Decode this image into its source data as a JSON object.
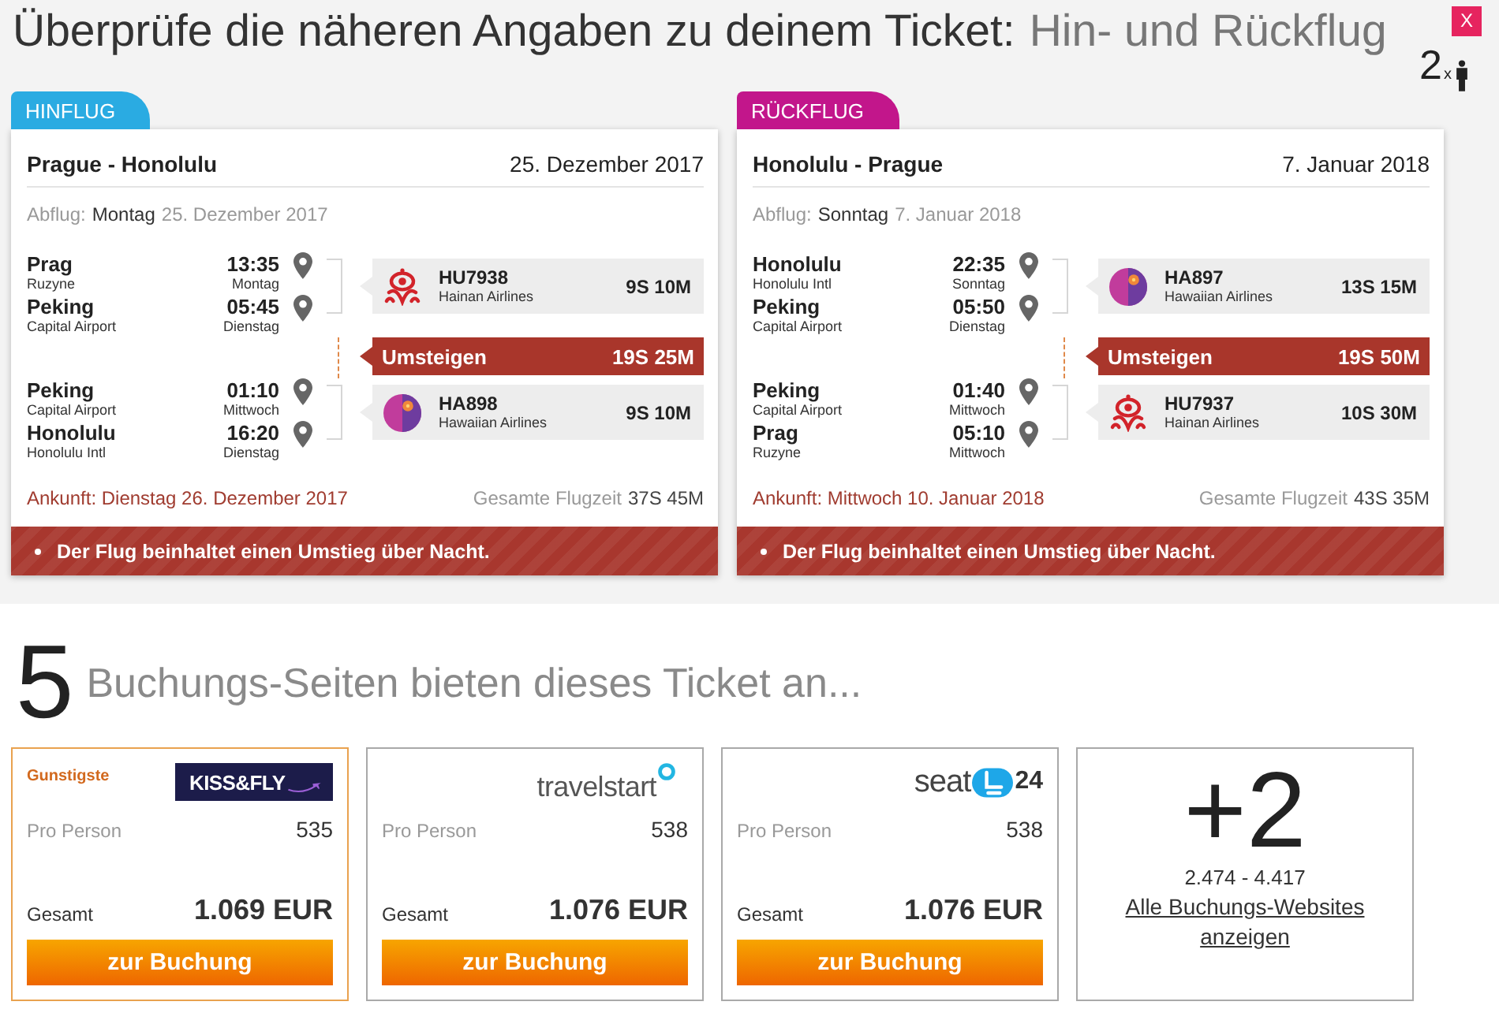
{
  "header": {
    "title": "Überprüfe die näheren Angaben zu deinem Ticket:",
    "trip_type": "Hin- und Rückflug",
    "passengers": "2$_{x}$",
    "close": "X"
  },
  "flights": [
    {
      "tab": "HINFLUG",
      "color": "#2aabe2",
      "route": "Prague - Honolulu",
      "date": "25. Dezember 2017",
      "departure": {
        "label": "Abflug:",
        "day": "Montag",
        "date": "25. Dezember 2017"
      },
      "legs": [
        {
          "kind": "segment",
          "stops": [
            {
              "city": "Prag",
              "airport": "Ruzyne",
              "time": "13:35",
              "day": "Montag"
            },
            {
              "city": "Peking",
              "airport": "Capital Airport",
              "time": "05:45",
              "day": "Dienstag"
            }
          ],
          "logo": {
            "kind": "swirl"
          },
          "flight_no": "HU7938",
          "airline": "Hainan Airlines",
          "duration": "9S 10M"
        },
        {
          "kind": "transfer",
          "label": "Umsteigen",
          "duration": "19S 25M"
        },
        {
          "kind": "segment",
          "stops": [
            {
              "city": "Peking",
              "airport": "Capital Airport",
              "time": "01:10",
              "day": "Mittwoch"
            },
            {
              "city": "Honolulu",
              "airport": "Honolulu Intl",
              "time": "16:20",
              "day": "Dienstag"
            }
          ],
          "logo": {
            "kind": "flower"
          },
          "flight_no": "HA898",
          "airline": "Hawaiian Airlines",
          "duration": "9S 10M"
        }
      ],
      "arrival": "Ankunft: Dienstag 26. Dezember 2017",
      "total_label": "Gesamte Flugzeit",
      "total": "37S 45M",
      "note": "Der Flug beinhaltet einen Umstieg über Nacht."
    },
    {
      "tab": "RÜCKFLUG",
      "color": "#c2168b",
      "route": "Honolulu - Prague",
      "date": "7. Januar 2018",
      "departure": {
        "label": "Abflug:",
        "day": "Sonntag",
        "date": "7. Januar 2018"
      },
      "legs": [
        {
          "kind": "segment",
          "stops": [
            {
              "city": "Honolulu",
              "airport": "Honolulu Intl",
              "time": "22:35",
              "day": "Sonntag"
            },
            {
              "city": "Peking",
              "airport": "Capital Airport",
              "time": "05:50",
              "day": "Dienstag"
            }
          ],
          "logo": {
            "kind": "flower"
          },
          "flight_no": "HA897",
          "airline": "Hawaiian Airlines",
          "duration": "13S 15M"
        },
        {
          "kind": "transfer",
          "label": "Umsteigen",
          "duration": "19S 50M"
        },
        {
          "kind": "segment",
          "stops": [
            {
              "city": "Peking",
              "airport": "Capital Airport",
              "time": "01:40",
              "day": "Mittwoch"
            },
            {
              "city": "Prag",
              "airport": "Ruzyne",
              "time": "05:10",
              "day": "Mittwoch"
            }
          ],
          "logo": {
            "kind": "swirl"
          },
          "flight_no": "HU7937",
          "airline": "Hainan Airlines",
          "duration": "10S 30M"
        }
      ],
      "arrival": "Ankunft: Mittwoch 10. Januar 2018",
      "total_label": "Gesamte Flugzeit",
      "total": "43S 35M",
      "note": "Der Flug beinhaltet einen Umstieg über Nacht."
    }
  ],
  "offers": {
    "count": "5",
    "heading": "Buchungs-Seiten bieten dieses Ticket an...",
    "items": [
      {
        "kind": "offer",
        "highlighted": true,
        "badge": "Gunstigste",
        "logo": {
          "kind": "box",
          "text": "KISS&FLY"
        },
        "per_person_label": "Pro Person",
        "per_person": "535",
        "total_label": "Gesamt",
        "total": "1.069 EUR",
        "button": "zur Buchung"
      },
      {
        "kind": "offer",
        "highlighted": false,
        "logo": {
          "kind": "ring",
          "text": "travelstart"
        },
        "per_person_label": "Pro Person",
        "per_person": "538",
        "total_label": "Gesamt",
        "total": "1.076 EUR",
        "button": "zur Buchung"
      },
      {
        "kind": "offer",
        "highlighted": false,
        "logo": {
          "kind": "seat",
          "text": "seat",
          "suffix": "24"
        },
        "per_person_label": "Pro Person",
        "per_person": "538",
        "total_label": "Gesamt",
        "total": "1.076 EUR",
        "button": "zur Buchung"
      },
      {
        "kind": "more",
        "count": "+2",
        "range": "2.474 - 4.417",
        "link": "Alle Buchungs-Websites anzeigen"
      }
    ]
  }
}
